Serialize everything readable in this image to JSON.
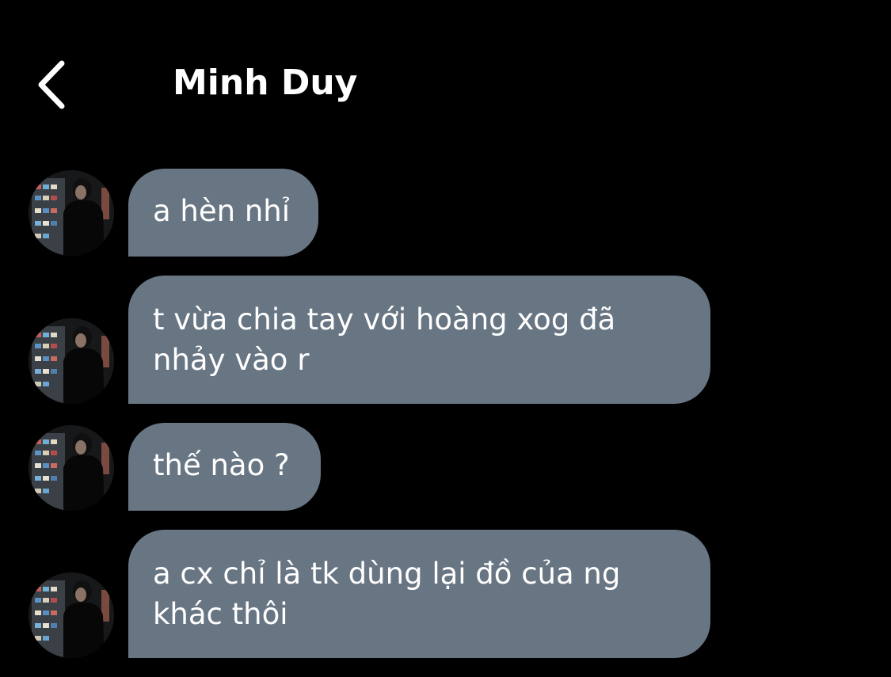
{
  "header": {
    "back_icon": "chevron-left-icon",
    "title": "Minh Duy"
  },
  "conversation": {
    "bubble_color": "#687583",
    "messages": [
      {
        "text": "a hèn nhỉ"
      },
      {
        "text": "t vừa chia tay với hoàng xog đã\nnhảy vào r"
      },
      {
        "text": "thế nào ?"
      },
      {
        "text": "a cx chỉ là tk dùng lại đồ của ng\nkhác thôi"
      }
    ]
  }
}
